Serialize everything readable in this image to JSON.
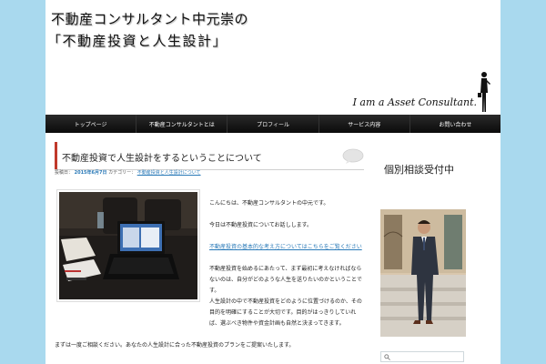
{
  "header": {
    "title": "不動産コンサルタント中元崇の",
    "subtitle": "「不動産投資と人生設計」",
    "tagline": "I am a Asset Consultant."
  },
  "nav": {
    "items": [
      {
        "label": "トップページ"
      },
      {
        "label": "不動産コンサルタントとは"
      },
      {
        "label": "プロフィール"
      },
      {
        "label": "サービス内容"
      },
      {
        "label": "お問い合わせ"
      }
    ]
  },
  "post": {
    "title": "不動産投資で人生設計をするということについて",
    "meta_prefix": "投稿日：",
    "date": "2015年6月7日",
    "meta_category_prefix": "カテゴリー：",
    "category": "不動産投資と人生設計について",
    "paragraphs": [
      {
        "text": "こんにちは、不動産コンサルタントの中元です。"
      },
      {
        "text": "今日は不動産投資についてお話しします。"
      },
      {
        "text": "不動産投資の基本的な考え方についてはこちらをご覧ください",
        "link": true
      },
      {
        "text": "不動産投資を始めるにあたって、まず最初に考えなければならないのは、自分がどのような人生を送りたいのかということです。"
      },
      {
        "text": "人生設計の中で不動産投資をどのように位置づけるのか、その目的を明確にすることが大切です。目的がはっきりしていれば、選ぶべき物件や資金計画も自然と決まってきます。"
      },
      {
        "text": "まずは一度ご相談ください。あなたの人生設計に合った不動産投資のプランをご提案いたします。"
      }
    ]
  },
  "sidebar": {
    "heading": "個別相談受付中",
    "search_placeholder": ""
  },
  "colors": {
    "background": "#a9d9ee",
    "nav_background": "#111111",
    "accent": "#c0392b",
    "link": "#2a7ab8"
  }
}
